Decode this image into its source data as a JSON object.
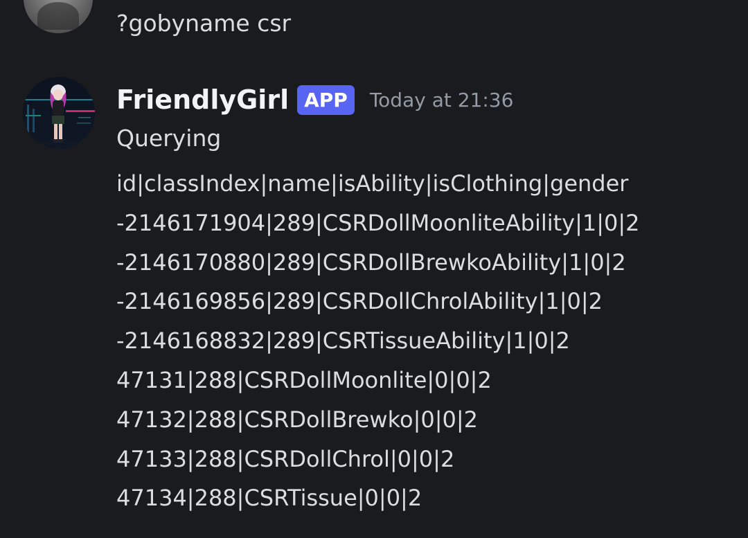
{
  "previous_message": {
    "text": "?gobyname csr"
  },
  "bot_message": {
    "username": "FriendlyGirl",
    "badge": "APP",
    "timestamp": "Today at 21:36",
    "status": "Querying",
    "lines": [
      "id|classIndex|name|isAbility|isClothing|gender",
      "-2146171904|289|CSRDollMoonliteAbility|1|0|2",
      "-2146170880|289|CSRDollBrewkoAbility|1|0|2",
      "-2146169856|289|CSRDollChrolAbility|1|0|2",
      "-2146168832|289|CSRTissueAbility|1|0|2",
      "47131|288|CSRDollMoonlite|0|0|2",
      "47132|288|CSRDollBrewko|0|0|2",
      "47133|288|CSRDollChrol|0|0|2",
      "47134|288|CSRTissue|0|0|2"
    ]
  },
  "colors": {
    "background": "#1a1b1f",
    "text": "#dbdee1",
    "username": "#f2f3f5",
    "badge": "#5865f2",
    "timestamp": "#949ba4"
  }
}
